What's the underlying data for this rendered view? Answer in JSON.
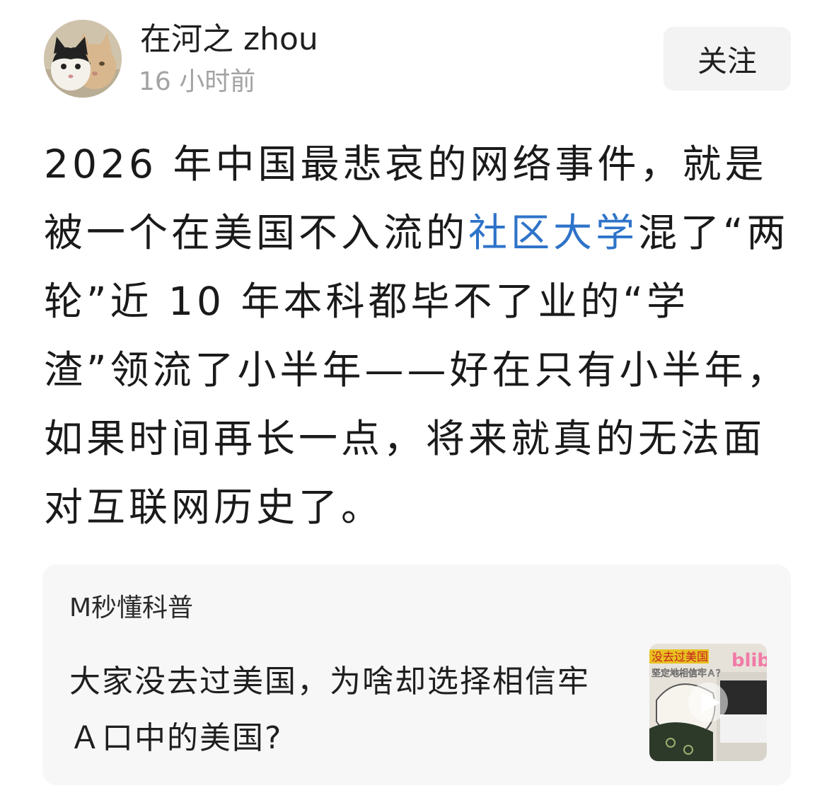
{
  "author": {
    "name": "在河之 zhou",
    "time": "16 小时前"
  },
  "follow_label": "关注",
  "post": {
    "text_before_link": "2026 年中国最悲哀的网络事件，就是被一个在美国不入流的",
    "link_text": "社区大学",
    "text_after_link": "混了“两轮”近 10 年本科都毕不了业的“学渣”领流了小半年——好在只有小半年，如果时间再长一点，将来就真的无法面对互联网历史了。"
  },
  "share_card": {
    "source": "M秒懂科普",
    "title": "大家没去过美国，为啥却选择相信牢Ａ口中的美国?",
    "thumbnail": {
      "logo_text": "blib",
      "caption_top": "没去过美国",
      "caption_bottom": "坚定地相信牢Ａ？"
    }
  },
  "colors": {
    "link": "#2e73c9",
    "secondary_text": "#a3a3a3",
    "card_background": "#f7f7f7",
    "button_background": "#f3f3f3"
  }
}
